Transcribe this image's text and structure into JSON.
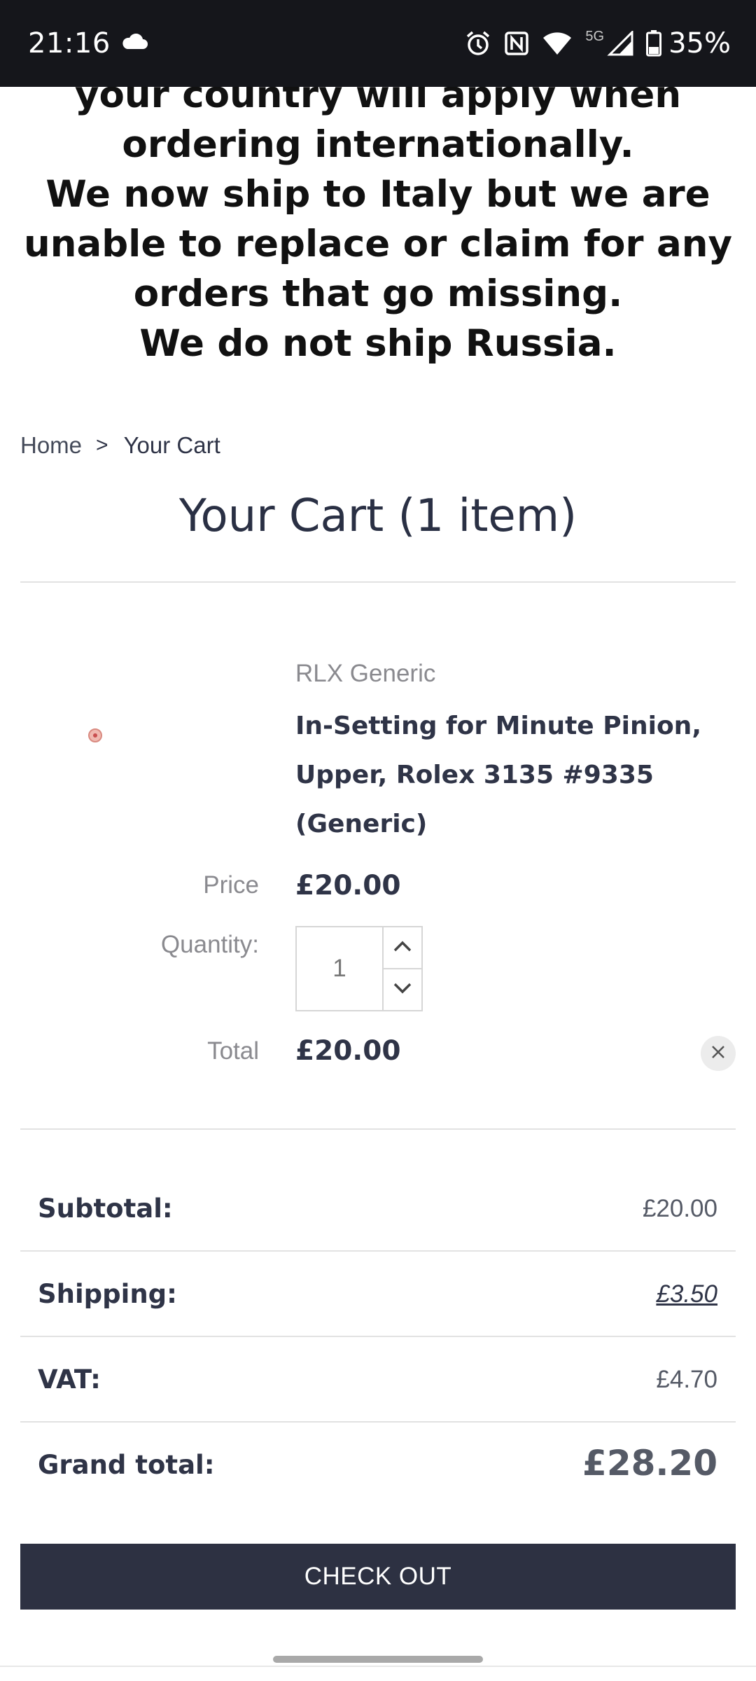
{
  "status_bar": {
    "time": "21:16",
    "network_label": "5G",
    "battery": "35%",
    "icons": [
      "cloud-icon",
      "alarm-icon",
      "nfc-icon",
      "wifi-icon",
      "signal-icon",
      "battery-icon"
    ]
  },
  "notice": {
    "lines": [
      "your country will apply when",
      "ordering internationally.",
      "We now ship to Italy but we are",
      "unable to replace or claim for any",
      "orders that go missing.",
      "We do not ship Russia."
    ]
  },
  "breadcrumb": {
    "home": "Home",
    "separator": ">",
    "current": "Your Cart"
  },
  "cart": {
    "title": "Your Cart (1 item)",
    "item": {
      "brand": "RLX Generic",
      "name_lines": [
        "In-Setting for Minute Pinion,",
        "Upper, Rolex 3135 #9335",
        "(Generic)"
      ],
      "price_label": "Price",
      "price": "£20.00",
      "quantity_label": "Quantity:",
      "quantity": "1",
      "total_label": "Total",
      "total": "£20.00"
    }
  },
  "totals": {
    "subtotal_label": "Subtotal:",
    "subtotal": "£20.00",
    "shipping_label": "Shipping:",
    "shipping": "£3.50",
    "vat_label": "VAT:",
    "vat": "£4.70",
    "grand_total_label": "Grand total:",
    "grand_total": "£28.20"
  },
  "checkout_label": "CHECK OUT",
  "colors": {
    "status_bar_bg": "#15161b",
    "text_dark": "#2f3447",
    "checkout_bg": "#2d3142",
    "muted": "#8a8a8f"
  }
}
